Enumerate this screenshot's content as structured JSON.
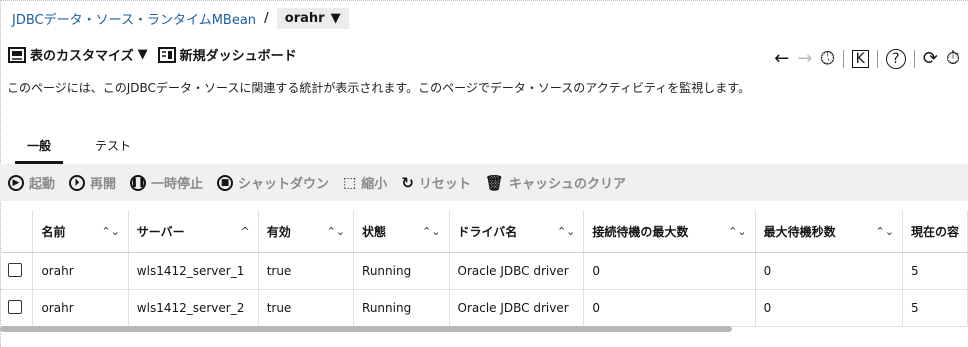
{
  "breadcrumb": {
    "link": "JDBCデータ・ソース・ランタイムMBean",
    "separator": "/",
    "current": "orahr"
  },
  "toolbar": {
    "customize_table": "表のカスタマイズ",
    "new_dashboard": "新規ダッシュボード"
  },
  "description": "このページには、このJDBCデータ・ソースに関連する統計が表示されます。このページでデータ・ソースのアクティビティを監視します。",
  "tabs": [
    {
      "label": "一般"
    },
    {
      "label": "テスト"
    }
  ],
  "actions": {
    "start": "起動",
    "resume": "再開",
    "suspend": "一時停止",
    "shutdown": "シャットダウン",
    "shrink": "縮小",
    "reset": "リセット",
    "clear_cache": "キャッシュのクリア"
  },
  "table": {
    "headers": [
      "名前",
      "サーバー",
      "有効",
      "状態",
      "ドライバ名",
      "接続待機の最大数",
      "最大待機秒数",
      "現在の容"
    ],
    "rows": [
      [
        "orahr",
        "wls1412_server_1",
        "true",
        "Running",
        "Oracle JDBC driver",
        "0",
        "0",
        "5"
      ],
      [
        "orahr",
        "wls1412_server_2",
        "true",
        "Running",
        "Oracle JDBC driver",
        "0",
        "0",
        "5"
      ]
    ]
  }
}
